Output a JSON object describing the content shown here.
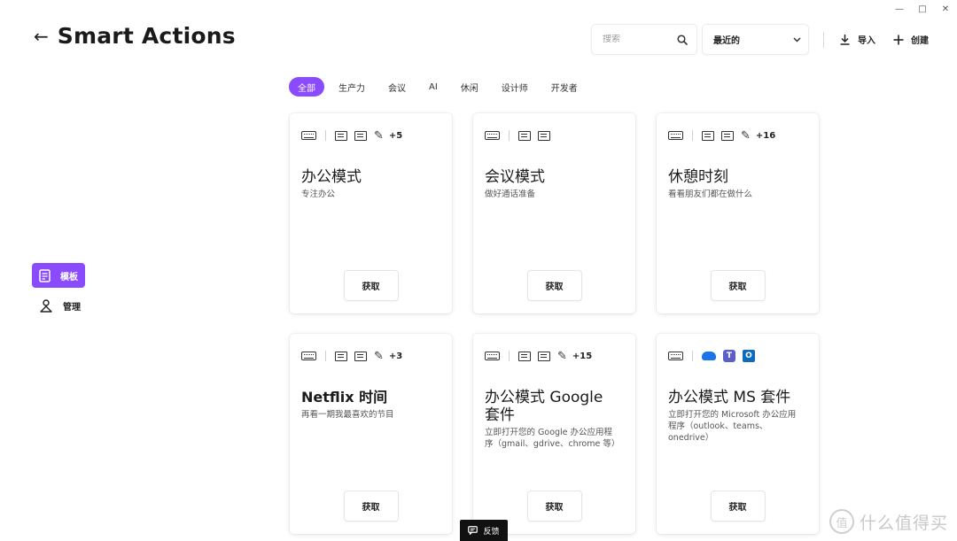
{
  "window": {
    "minimize": "—",
    "maximize": "□",
    "close": "✕"
  },
  "header": {
    "title": "Smart Actions"
  },
  "search": {
    "placeholder": "搜索"
  },
  "sort": {
    "selected": "最近的"
  },
  "actions": {
    "import_label": "导入",
    "create_label": "创建"
  },
  "sidebar": {
    "items": [
      {
        "label": "模板",
        "icon": "template-icon",
        "active": true
      },
      {
        "label": "管理",
        "icon": "manage-icon",
        "active": false
      }
    ]
  },
  "filters": [
    "全部",
    "生产力",
    "会议",
    "AI",
    "休闲",
    "设计师",
    "开发者"
  ],
  "cards": [
    {
      "title": "办公模式",
      "desc": "专注办公",
      "more": "+5",
      "icons": [
        "keyboard-icon",
        "message-icon",
        "message-icon",
        "pencil-icon"
      ],
      "button": "获取"
    },
    {
      "title": "会议模式",
      "desc": "做好通话准备",
      "more": "",
      "icons": [
        "keyboard-icon",
        "message-icon",
        "message-icon"
      ],
      "button": "获取"
    },
    {
      "title": "休憩时刻",
      "desc": "看看朋友们都在做什么",
      "more": "+16",
      "icons": [
        "keyboard-icon",
        "message-icon",
        "message-icon",
        "pencil-icon"
      ],
      "button": "获取"
    },
    {
      "title": "Netflix 时间",
      "desc": "再看一期我最喜欢的节目",
      "more": "+3",
      "icons": [
        "keyboard-icon",
        "message-icon",
        "message-icon",
        "pencil-icon"
      ],
      "button": "获取"
    },
    {
      "title": "办公模式 Google 套件",
      "desc": "立即打开您的 Google 办公应用程序（gmail、gdrive、chrome 等）",
      "more": "+15",
      "icons": [
        "keyboard-icon",
        "message-icon",
        "message-icon",
        "pencil-icon"
      ],
      "button": "获取"
    },
    {
      "title": "办公模式 MS 套件",
      "desc": "立即打开您的 Microsoft 办公应用程序（outlook、teams、onedrive）",
      "more": "",
      "icons": [
        "keyboard-icon",
        "onedrive-icon",
        "teams-icon",
        "outlook-icon"
      ],
      "button": "获取"
    }
  ],
  "feedback": {
    "label": "反馈"
  },
  "watermark": {
    "text": "什么值得买"
  },
  "colors": {
    "accent": "#8a4bff"
  }
}
